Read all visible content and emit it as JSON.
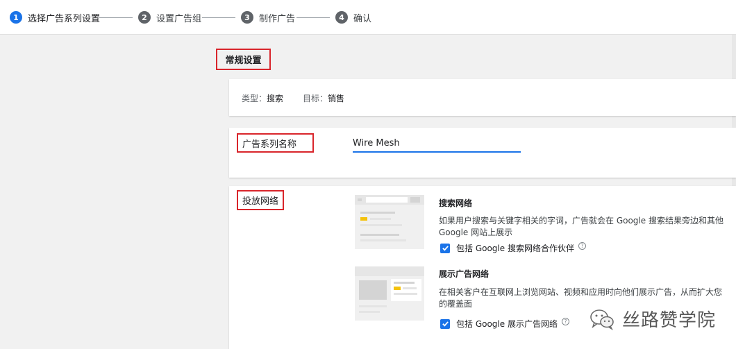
{
  "stepper": {
    "steps": [
      {
        "num": "1",
        "label": "选择广告系列设置"
      },
      {
        "num": "2",
        "label": "设置广告组"
      },
      {
        "num": "3",
        "label": "制作广告"
      },
      {
        "num": "4",
        "label": "确认"
      }
    ]
  },
  "general": {
    "heading": "常规设置",
    "type_label": "类型：",
    "type_value": "搜索",
    "goal_label": "目标：",
    "goal_value": "销售"
  },
  "campaign_name": {
    "label": "广告系列名称",
    "value": "Wire Mesh"
  },
  "networks": {
    "label": "投放网络",
    "search": {
      "title": "搜索网络",
      "description": "如果用户搜索与关键字相关的字词，广告就会在 Google 搜索结果旁边和其他 Google 网站上展示",
      "checkbox_label": "包括 Google 搜索网络合作伙伴",
      "checked": true
    },
    "display": {
      "title": "展示广告网络",
      "description": "在相关客户在互联网上浏览网站、视频和应用时向他们展示广告，从而扩大您的覆盖面",
      "checkbox_label": "包括 Google 展示广告网络",
      "checked": true
    }
  },
  "watermark": {
    "text": "丝路赞学院",
    "icon": "wechat-icon"
  },
  "colors": {
    "accent": "#1a73e8",
    "highlight_border": "#d9252b",
    "ad_yellow": "#f4c20d"
  }
}
